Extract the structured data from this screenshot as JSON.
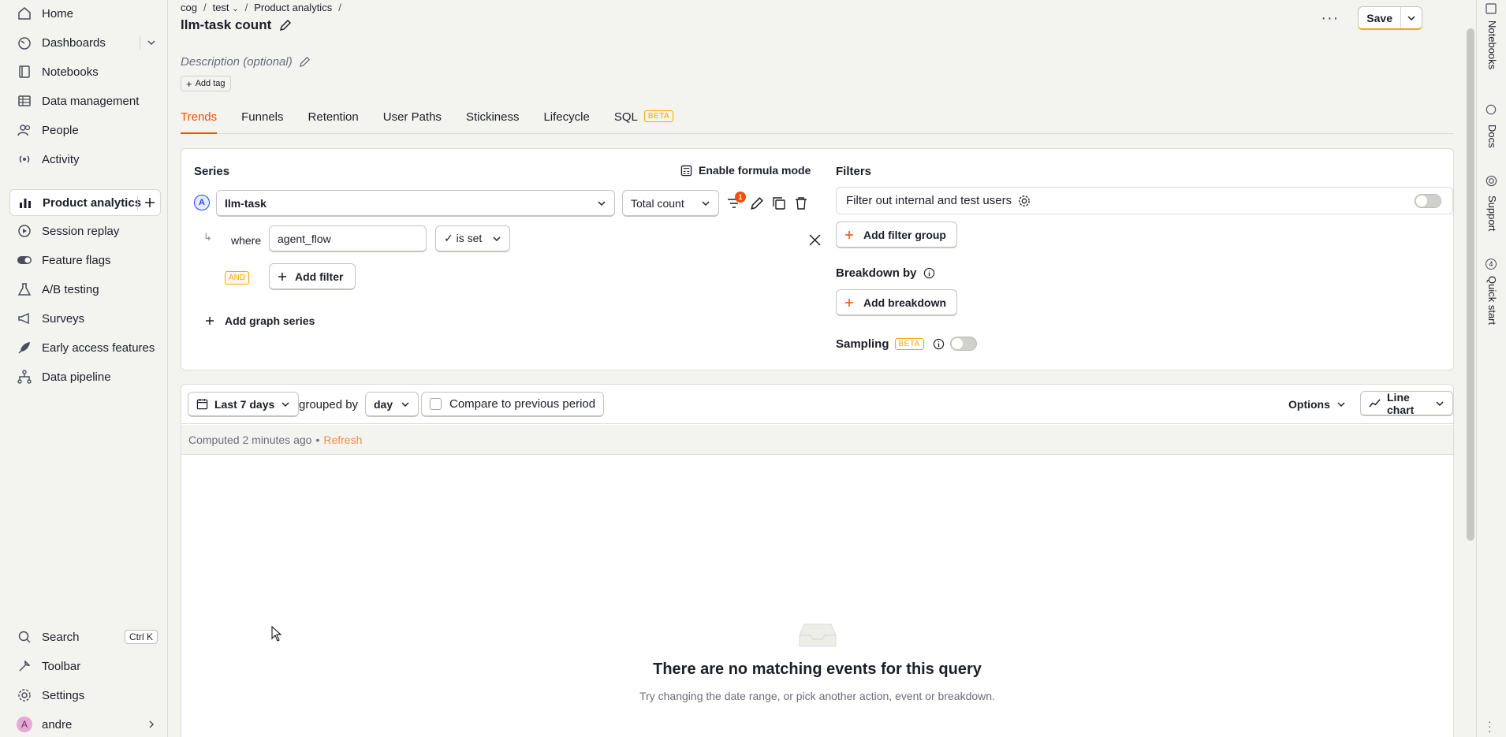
{
  "sidebar": {
    "items": [
      {
        "label": "Home",
        "icon": "home-icon"
      },
      {
        "label": "Dashboards",
        "icon": "dashboard-icon"
      },
      {
        "label": "Notebooks",
        "icon": "notebook-icon"
      },
      {
        "label": "Data management",
        "icon": "database-icon"
      },
      {
        "label": "People",
        "icon": "people-icon"
      },
      {
        "label": "Activity",
        "icon": "activity-icon"
      },
      {
        "label": "Product analytics",
        "icon": "bar-chart-icon"
      },
      {
        "label": "Session replay",
        "icon": "replay-icon"
      },
      {
        "label": "Feature flags",
        "icon": "toggle-icon"
      },
      {
        "label": "A/B testing",
        "icon": "flask-icon"
      },
      {
        "label": "Surveys",
        "icon": "megaphone-icon"
      },
      {
        "label": "Early access features",
        "icon": "rocket-icon"
      },
      {
        "label": "Data pipeline",
        "icon": "pipeline-icon"
      }
    ],
    "bottom": {
      "search": "Search",
      "search_shortcut": "Ctrl K",
      "toolbar": "Toolbar",
      "settings": "Settings",
      "user": "andre",
      "user_initial": "A"
    }
  },
  "breadcrumb": [
    "cog",
    "/",
    "test",
    "/",
    "Product analytics",
    "/"
  ],
  "page": {
    "title": "llm-task count",
    "description_placeholder": "Description (optional)",
    "add_tag": "Add tag",
    "save": "Save"
  },
  "tabs": [
    {
      "label": "Trends",
      "active": true
    },
    {
      "label": "Funnels"
    },
    {
      "label": "Retention"
    },
    {
      "label": "User Paths"
    },
    {
      "label": "Stickiness"
    },
    {
      "label": "Lifecycle"
    },
    {
      "label": "SQL",
      "badge": "BETA"
    }
  ],
  "series": {
    "heading": "Series",
    "formula_mode": "Enable formula mode",
    "letter": "A",
    "event": "llm-task",
    "aggregation": "Total count",
    "filter_count": "1",
    "where": "where",
    "property": "agent_flow",
    "operator": "✓ is set",
    "and": "AND",
    "add_filter": "Add filter",
    "add_graph_series": "Add graph series"
  },
  "filters": {
    "heading": "Filters",
    "internal_users": "Filter out internal and test users",
    "add_filter_group": "Add filter group",
    "breakdown_heading": "Breakdown by",
    "add_breakdown": "Add breakdown",
    "sampling": "Sampling",
    "sampling_badge": "BETA"
  },
  "query_bar": {
    "date_range": "Last 7 days",
    "grouped_by": "grouped by",
    "interval": "day",
    "compare": "Compare to previous period",
    "options": "Options",
    "chart_type": "Line chart"
  },
  "results": {
    "computed": "Computed 2 minutes ago",
    "separator": "•",
    "refresh": "Refresh",
    "empty_title": "There are no matching events for this query",
    "empty_hint": "Try changing the date range, or pick another action, event or breakdown."
  },
  "right_rail": [
    "Notebooks",
    "Docs",
    "Support",
    "Quick start"
  ],
  "right_rail_quickstart_count": "4",
  "colors": {
    "accent": "#f54e00",
    "warning": "#f7a501",
    "link": "#f08a4b",
    "series_a": "#1d4aff"
  }
}
